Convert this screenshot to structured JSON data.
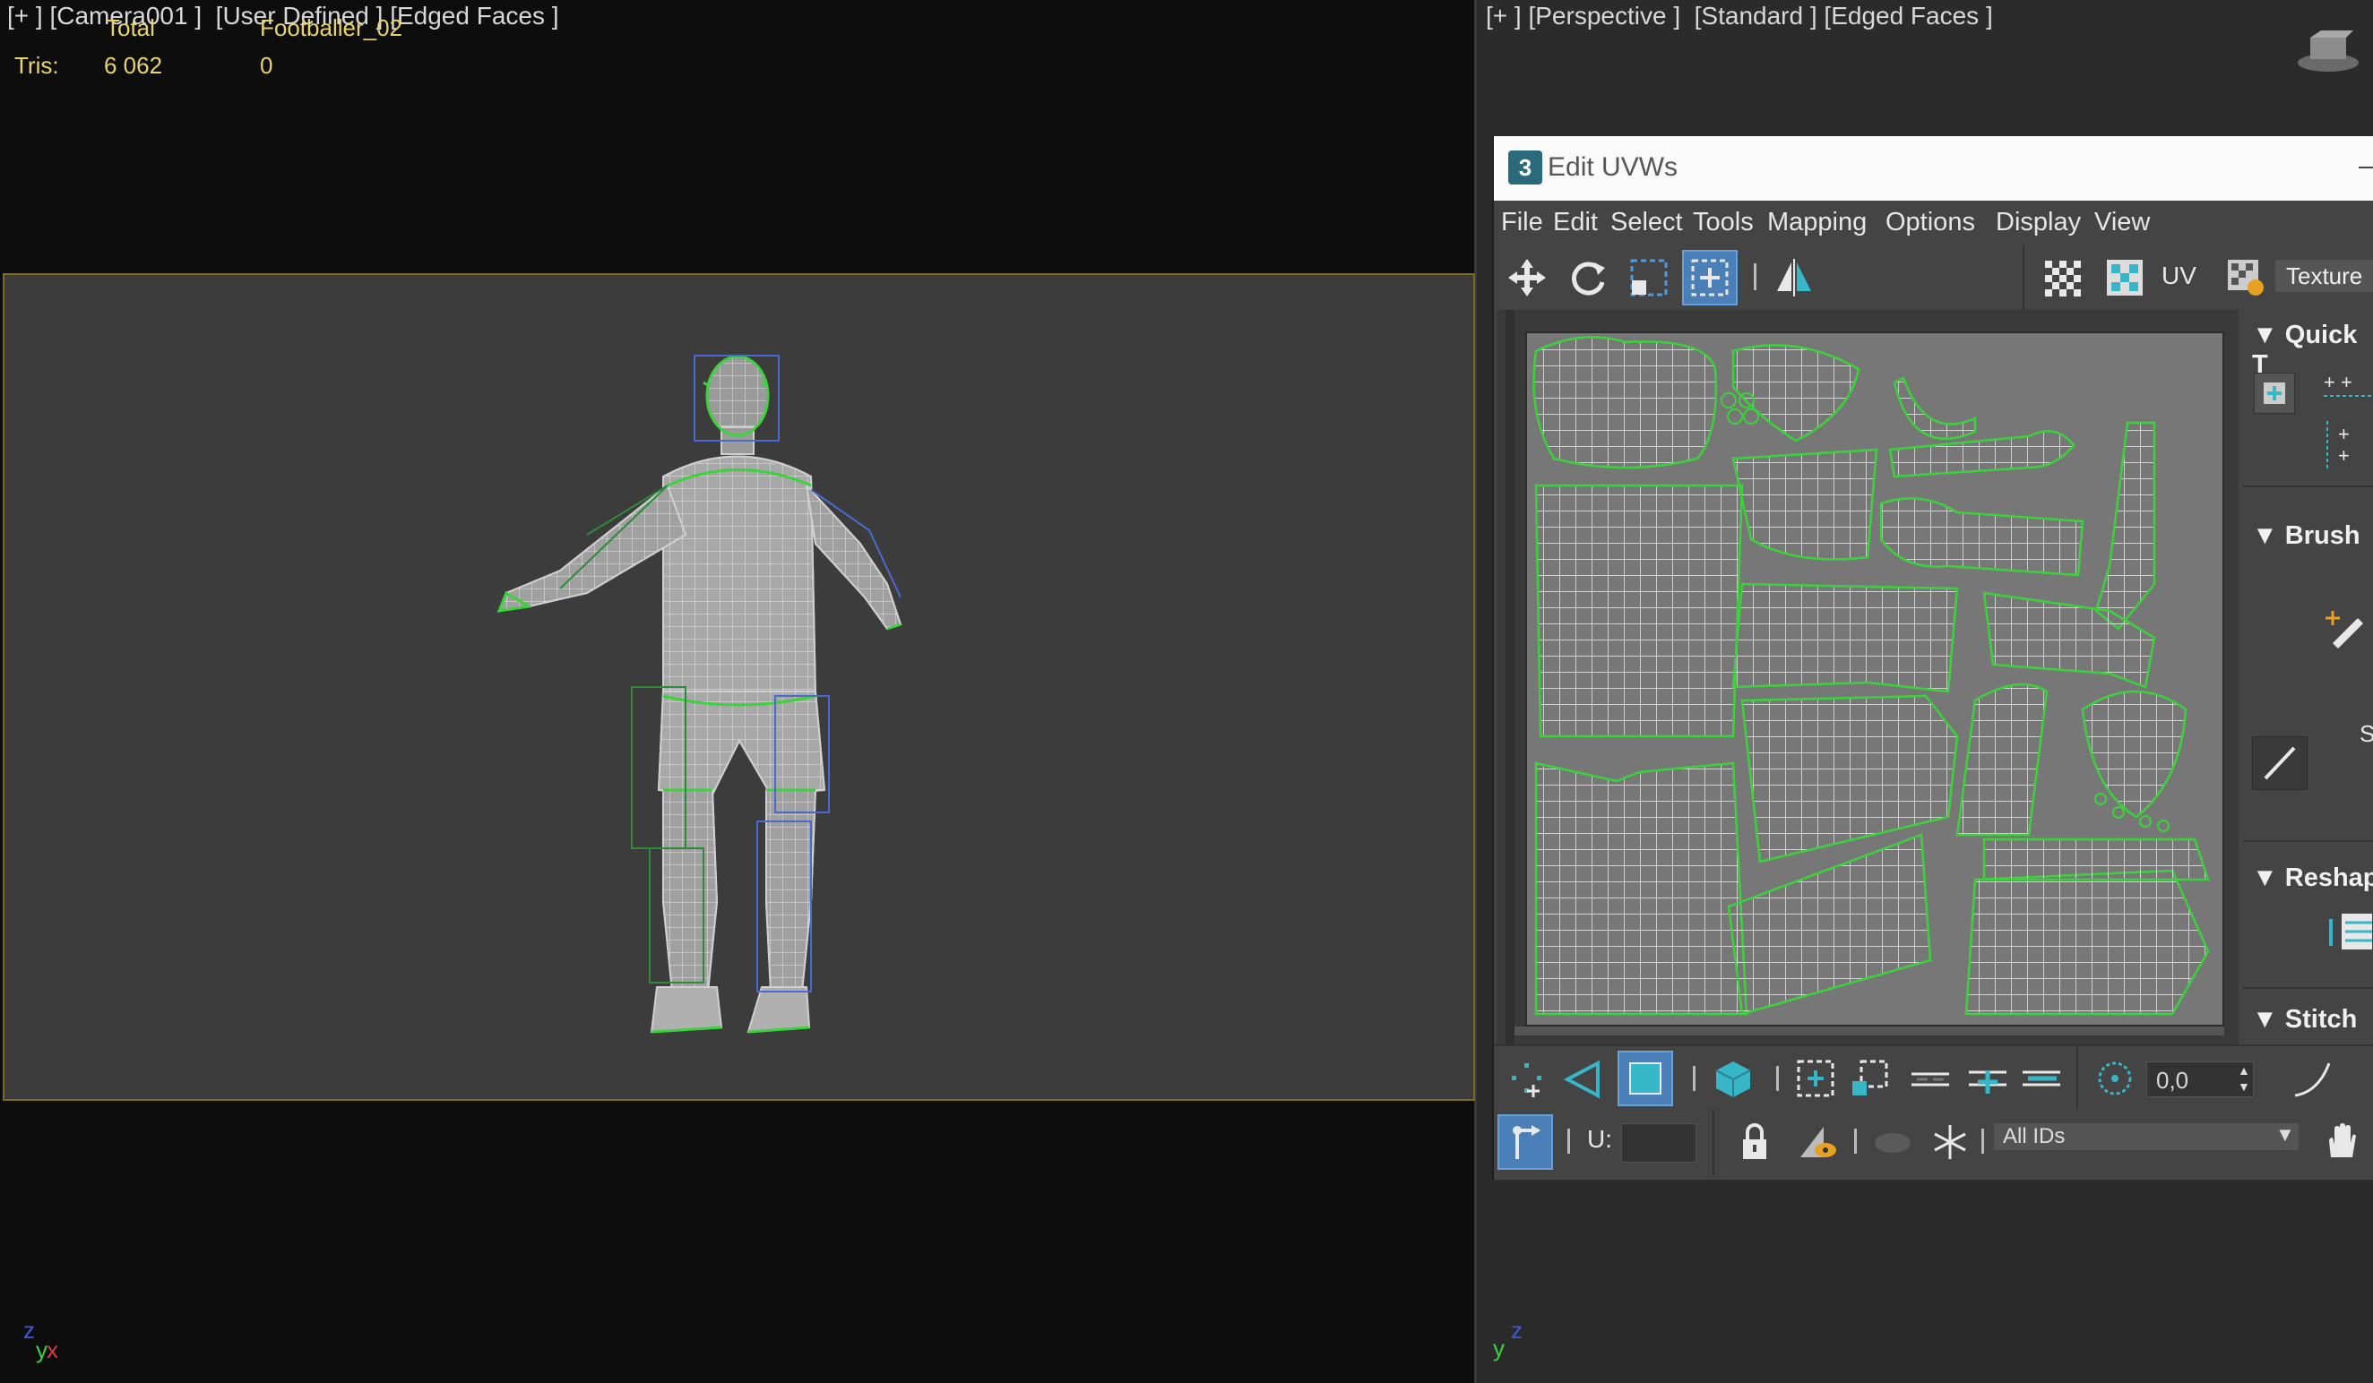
{
  "left_viewport": {
    "label": "[+ ] [Camera001 ]  [User Defined ] [Edged Faces ]",
    "stats": {
      "col_total": "Total",
      "col_object": "Footballer_02",
      "row_label": "Tris:",
      "total_value": "6 062",
      "object_value": "0"
    },
    "axis": {
      "z": "z",
      "y": "y",
      "x": "x"
    }
  },
  "right_viewport": {
    "label": "[+ ] [Perspective ]  [Standard ] [Edged Faces ]",
    "axis": {
      "y": "y",
      "z": "z"
    }
  },
  "uvw_window": {
    "title": "Edit UVWs",
    "app_icon_text": "3",
    "menu": [
      "File",
      "Edit",
      "Select",
      "Tools",
      "Mapping",
      "Options",
      "Display",
      "View"
    ],
    "toolbar": {
      "uv_label": "UV",
      "texture_dropdown": "Texture"
    },
    "rollouts": [
      "Quick T",
      "Brush",
      "Reshap",
      "Stitch"
    ],
    "brush_partial_text": "S",
    "bottom": {
      "spinner_value": "0,0",
      "u_label": "U:",
      "ids_dropdown": "All IDs"
    }
  },
  "colors": {
    "accent_blue": "#4a7fb8",
    "teal": "#37b6c8",
    "stat_yellow": "#e8d46a",
    "uv_green": "#3cd23c"
  }
}
